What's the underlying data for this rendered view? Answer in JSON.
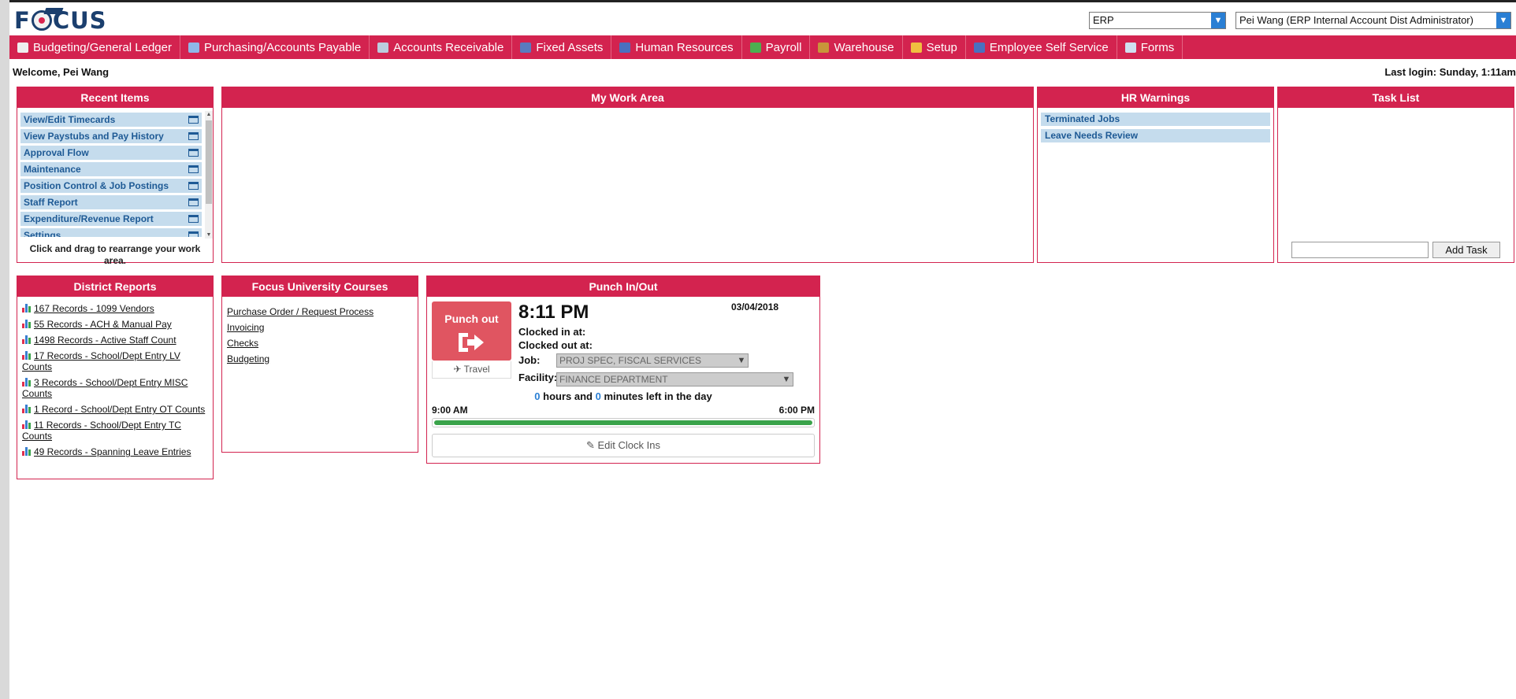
{
  "header": {
    "logo_text": "FOCUS",
    "erp_select": "ERP",
    "user_select": "Pei Wang (ERP Internal Account Dist Administrator)"
  },
  "nav": [
    {
      "label": "Budgeting/General Ledger",
      "icon": "ledger-icon"
    },
    {
      "label": "Purchasing/Accounts Payable",
      "icon": "credit-card-icon"
    },
    {
      "label": "Accounts Receivable",
      "icon": "register-icon"
    },
    {
      "label": "Fixed Assets",
      "icon": "house-icon"
    },
    {
      "label": "Human Resources",
      "icon": "people-icon"
    },
    {
      "label": "Payroll",
      "icon": "dollar-coin-icon"
    },
    {
      "label": "Warehouse",
      "icon": "hammer-icon"
    },
    {
      "label": "Setup",
      "icon": "tools-icon"
    },
    {
      "label": "Employee Self Service",
      "icon": "people-icon"
    },
    {
      "label": "Forms",
      "icon": "form-icon"
    }
  ],
  "welcome": "Welcome, Pei Wang",
  "last_login": "Last login: Sunday, 1:11am",
  "recent_items": {
    "title": "Recent Items",
    "items": [
      "View/Edit Timecards",
      "View Paystubs and Pay History",
      "Approval Flow",
      "Maintenance",
      "Position Control & Job Postings",
      "Staff Report",
      "Expenditure/Revenue Report",
      "Settings"
    ],
    "note": "Click and drag to rearrange your work area."
  },
  "work_area": {
    "title": "My Work Area"
  },
  "hr_warnings": {
    "title": "HR Warnings",
    "items": [
      "Terminated Jobs",
      "Leave Needs Review"
    ]
  },
  "task_list": {
    "title": "Task List",
    "add_label": "Add Task",
    "input_value": ""
  },
  "district_reports": {
    "title": "District Reports",
    "items": [
      "167 Records - 1099 Vendors",
      "55 Records - ACH & Manual Pay",
      "1498 Records - Active Staff Count",
      "17 Records - School/Dept Entry LV Counts",
      "3 Records - School/Dept Entry MISC Counts",
      "1 Record - School/Dept Entry OT Counts",
      "11 Records - School/Dept Entry TC Counts",
      "49 Records - Spanning Leave Entries"
    ]
  },
  "focus_courses": {
    "title": "Focus University Courses",
    "items": [
      "Purchase Order / Request Process",
      "Invoicing",
      "Checks",
      "Budgeting"
    ]
  },
  "punch": {
    "title": "Punch In/Out",
    "button_label": "Punch out",
    "travel_label": "Travel",
    "time": "8:11 PM",
    "date": "03/04/2018",
    "clocked_in_label": "Clocked in at:",
    "clocked_out_label": "Clocked out at:",
    "job_label": "Job:",
    "job_value": "PROJ SPEC, FISCAL SERVICES",
    "facility_label": "Facility:",
    "facility_value": "FINANCE DEPARTMENT",
    "hours_left": "0",
    "hours_text": "hours and",
    "minutes_left": "0",
    "minutes_text": "minutes left in the day",
    "start_time": "9:00 AM",
    "end_time": "6:00 PM",
    "progress": 1.0,
    "edit_label": "Edit Clock Ins"
  },
  "colors": {
    "brand": "#d3234f",
    "link": "#1e5a95",
    "progress": "#3aa34a"
  }
}
